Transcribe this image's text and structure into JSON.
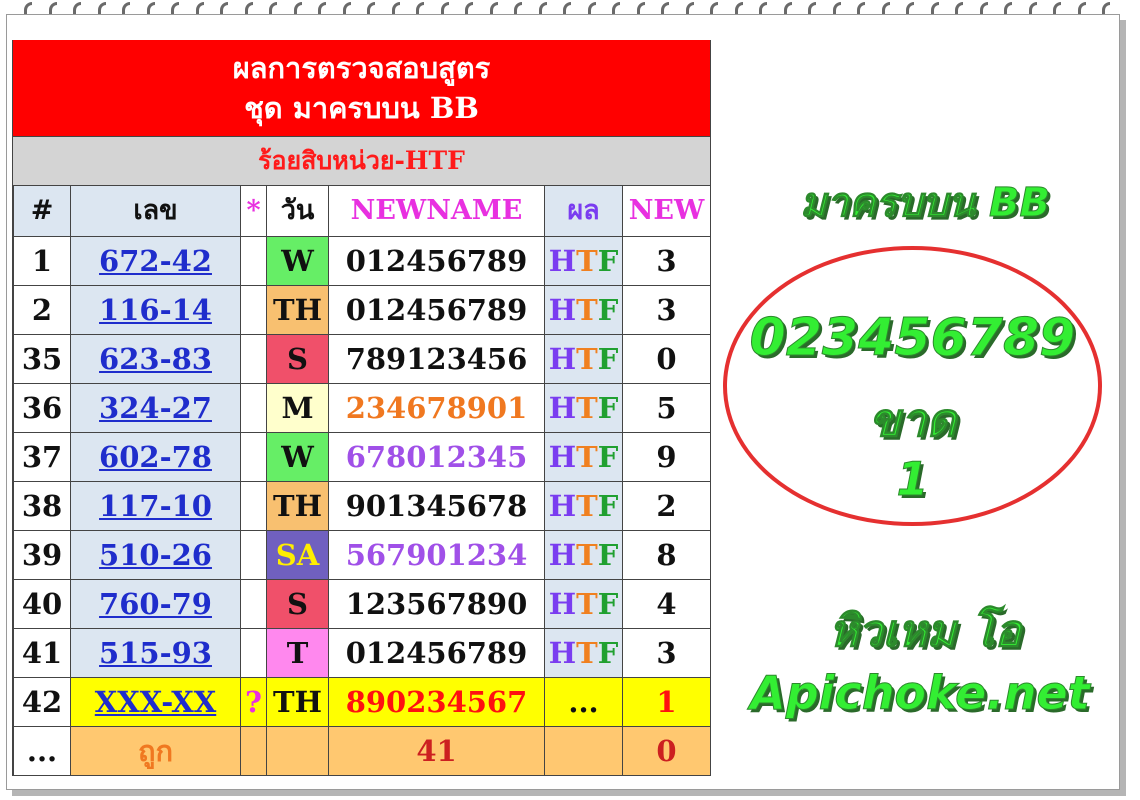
{
  "header": {
    "title_line1": "ผลการตรวจสอบสูตร",
    "title_line2": "ชุด มาครบบน BB",
    "subtitle": "ร้อยสิบหน่วย-HTF"
  },
  "columns": [
    "#",
    "เลข",
    "*",
    "วัน",
    "NEWNAME",
    "ผล",
    "NEW"
  ],
  "rows": [
    {
      "id": "1",
      "num": "672-42",
      "star": "",
      "day": "W",
      "day_bg": "#66ee66",
      "day_color": "#111111",
      "newname": "012456789",
      "nn_color": "#111111",
      "res": "HTF",
      "new": "3"
    },
    {
      "id": "2",
      "num": "116-14",
      "star": "",
      "day": "TH",
      "day_bg": "#f8c070",
      "day_color": "#111111",
      "newname": "012456789",
      "nn_color": "#111111",
      "res": "HTF",
      "new": "3"
    },
    {
      "id": "35",
      "num": "623-83",
      "star": "",
      "day": "S",
      "day_bg": "#f0506a",
      "day_color": "#111111",
      "newname": "789123456",
      "nn_color": "#111111",
      "res": "HTF",
      "new": "0"
    },
    {
      "id": "36",
      "num": "324-27",
      "star": "",
      "day": "M",
      "day_bg": "#ffffcc",
      "day_color": "#111111",
      "newname": "234678901",
      "nn_color": "#f07820",
      "res": "HTF",
      "new": "5"
    },
    {
      "id": "37",
      "num": "602-78",
      "star": "",
      "day": "W",
      "day_bg": "#66ee66",
      "day_color": "#111111",
      "newname": "678012345",
      "nn_color": "#a050e8",
      "res": "HTF",
      "new": "9"
    },
    {
      "id": "38",
      "num": "117-10",
      "star": "",
      "day": "TH",
      "day_bg": "#f8c070",
      "day_color": "#111111",
      "newname": "901345678",
      "nn_color": "#111111",
      "res": "HTF",
      "new": "2"
    },
    {
      "id": "39",
      "num": "510-26",
      "star": "",
      "day": "SA",
      "day_bg": "#7060c0",
      "day_color": "#ffee00",
      "newname": "567901234",
      "nn_color": "#a050e8",
      "res": "HTF",
      "new": "8"
    },
    {
      "id": "40",
      "num": "760-79",
      "star": "",
      "day": "S",
      "day_bg": "#f0506a",
      "day_color": "#111111",
      "newname": "123567890",
      "nn_color": "#111111",
      "res": "HTF",
      "new": "4"
    },
    {
      "id": "41",
      "num": "515-93",
      "star": "",
      "day": "T",
      "day_bg": "#ff88ee",
      "day_color": "#111111",
      "newname": "012456789",
      "nn_color": "#111111",
      "res": "HTF",
      "new": "3"
    }
  ],
  "pending_row": {
    "id": "42",
    "num": "XXX-XX",
    "star": "?",
    "day": "TH",
    "newname": "890234567",
    "res": "...",
    "new": "1"
  },
  "footer_row": {
    "id": "...",
    "label": "ถูก",
    "count": "41",
    "new": "0"
  },
  "right": {
    "title": "มาครบบน BB",
    "numbers": "023456789",
    "missing_label": "ขาด",
    "missing_value": "1",
    "author": "หิวเหม โอ",
    "site": "Apichoke.net"
  },
  "colors": {
    "title_bg": "#ff0000",
    "subtitle_text": "#ff1a1a",
    "highlight_row": "#ffff00",
    "footer_row": "#ffc870",
    "glow_green": "#33ee33"
  }
}
